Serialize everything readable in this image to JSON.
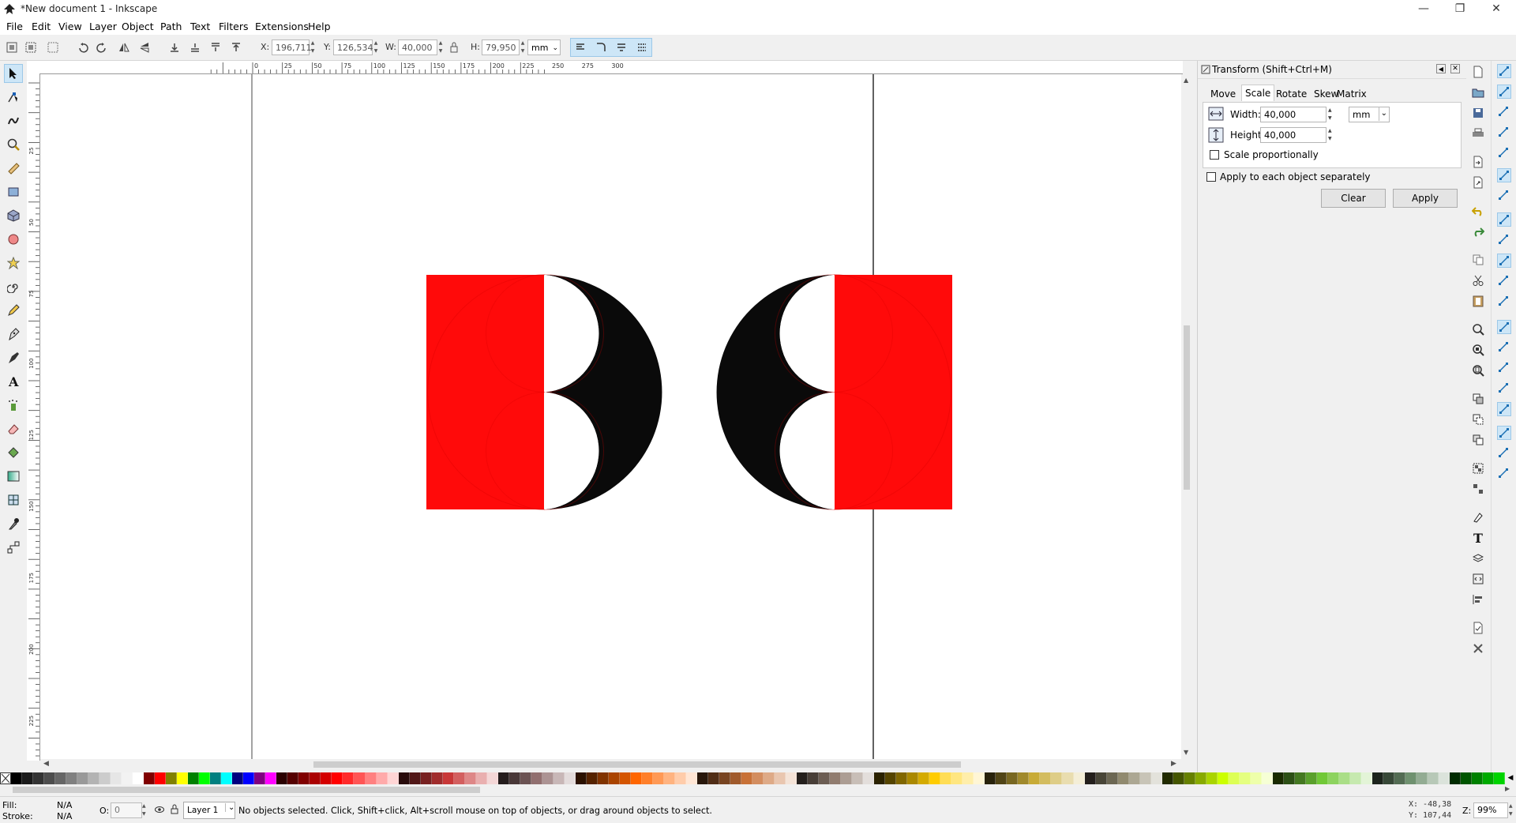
{
  "window": {
    "title": "*New document 1 - Inkscape"
  },
  "menu": [
    "File",
    "Edit",
    "View",
    "Layer",
    "Object",
    "Path",
    "Text",
    "Filters",
    "Extensions",
    "Help"
  ],
  "toolbar": {
    "x_label": "X:",
    "x_value": "196,711",
    "y_label": "Y:",
    "y_value": "126,534",
    "w_label": "W:",
    "w_value": "40,000",
    "h_label": "H:",
    "h_value": "79,950",
    "unit": "mm"
  },
  "ruler": {
    "h_labels": [
      "0",
      "25",
      "50",
      "75",
      "100",
      "125",
      "150",
      "175",
      "200",
      "225",
      "250",
      "275",
      "300"
    ],
    "v_labels": [
      "25",
      "50",
      "75",
      "100",
      "125",
      "150",
      "175",
      "200",
      "225"
    ]
  },
  "dialog": {
    "title": "Transform (Shift+Ctrl+M)",
    "tabs": [
      "Move",
      "Scale",
      "Rotate",
      "Skew",
      "Matrix"
    ],
    "active_tab": "Scale",
    "width_label": "Width:",
    "width_value": "40,000",
    "unit": "mm",
    "height_label": "Height:",
    "height_value": "40,000",
    "scale_prop_label": "Scale proportionally",
    "apply_each_label": "Apply to each object separately",
    "clear_label": "Clear",
    "apply_label": "Apply"
  },
  "status": {
    "fill_label": "Fill:",
    "fill_value": "N/A",
    "stroke_label": "Stroke:",
    "stroke_value": "N/A",
    "opacity_label": "O:",
    "opacity_value": "0",
    "layer": "Layer 1",
    "message": "No objects selected. Click, Shift+click, Alt+scroll mouse on top of objects, or drag around objects to select.",
    "cursor_x": "X: -48,38",
    "cursor_y": "Y: 107,44",
    "zoom_label": "Z:",
    "zoom_value": "99%"
  },
  "colors": {
    "red": "#ff0a0a",
    "black": "#0a0a0a",
    "palette": [
      "#000000",
      "#1a1a1a",
      "#333333",
      "#4d4d4d",
      "#666666",
      "#808080",
      "#999999",
      "#b3b3b3",
      "#cccccc",
      "#e6e6e6",
      "#f2f2f2",
      "#ffffff",
      "#800000",
      "#ff0000",
      "#808000",
      "#ffff00",
      "#008000",
      "#00ff00",
      "#008080",
      "#00ffff",
      "#000080",
      "#0000ff",
      "#800080",
      "#ff00ff",
      "#2b0000",
      "#550000",
      "#800000",
      "#aa0000",
      "#d40000",
      "#ff0000",
      "#ff2a2a",
      "#ff5555",
      "#ff8080",
      "#ffaaaa",
      "#ffd5d5",
      "#280b0b",
      "#501616",
      "#782121",
      "#a02c2c",
      "#c83737",
      "#d35f5f",
      "#de8787",
      "#e9afaf",
      "#f4d7d7",
      "#241c1c",
      "#483737",
      "#6c5353",
      "#916f6f",
      "#ac9393",
      "#c8b7b7",
      "#e3dbdb",
      "#2b1100",
      "#552200",
      "#803300",
      "#aa4400",
      "#d45500",
      "#ff6600",
      "#ff7f2a",
      "#ff9955",
      "#ffb380",
      "#ffccaa",
      "#ffe6d5",
      "#28170b",
      "#502d16",
      "#784421",
      "#a05a2c",
      "#c87137",
      "#d38d5f",
      "#deaa87",
      "#e9c6af",
      "#f4e3d7",
      "#241f1c",
      "#483e37",
      "#6c5d53",
      "#917c6f",
      "#ac9d93",
      "#c8beb7",
      "#e3dedb",
      "#2b2200",
      "#554400",
      "#806600",
      "#aa8800",
      "#d4aa00",
      "#ffcc00",
      "#ffdd55",
      "#ffe680",
      "#ffeeaa",
      "#fff6d5",
      "#28220b",
      "#504416",
      "#786721",
      "#a0892c",
      "#c8ab37",
      "#d3bc5f",
      "#decd87",
      "#e9ddaf",
      "#f4eed7",
      "#241f1c",
      "#484537",
      "#6c6753",
      "#918a6f",
      "#aca793",
      "#c8c4b7",
      "#e3e2db",
      "#222b00",
      "#445500",
      "#668000",
      "#88aa00",
      "#aad400",
      "#ccff00",
      "#ddff55",
      "#e5ff80",
      "#eeffaa",
      "#f6ffd5",
      "#1a2b00",
      "#2d5016",
      "#447821",
      "#5aa02c",
      "#71c837",
      "#8dd35f",
      "#aade87",
      "#c6e9af",
      "#e3f4d7",
      "#1c241c",
      "#374837",
      "#536c53",
      "#6f916f",
      "#93ac93",
      "#b7c8b7",
      "#dbe3db",
      "#002b00",
      "#005500",
      "#008000",
      "#00aa00",
      "#00d400"
    ]
  }
}
